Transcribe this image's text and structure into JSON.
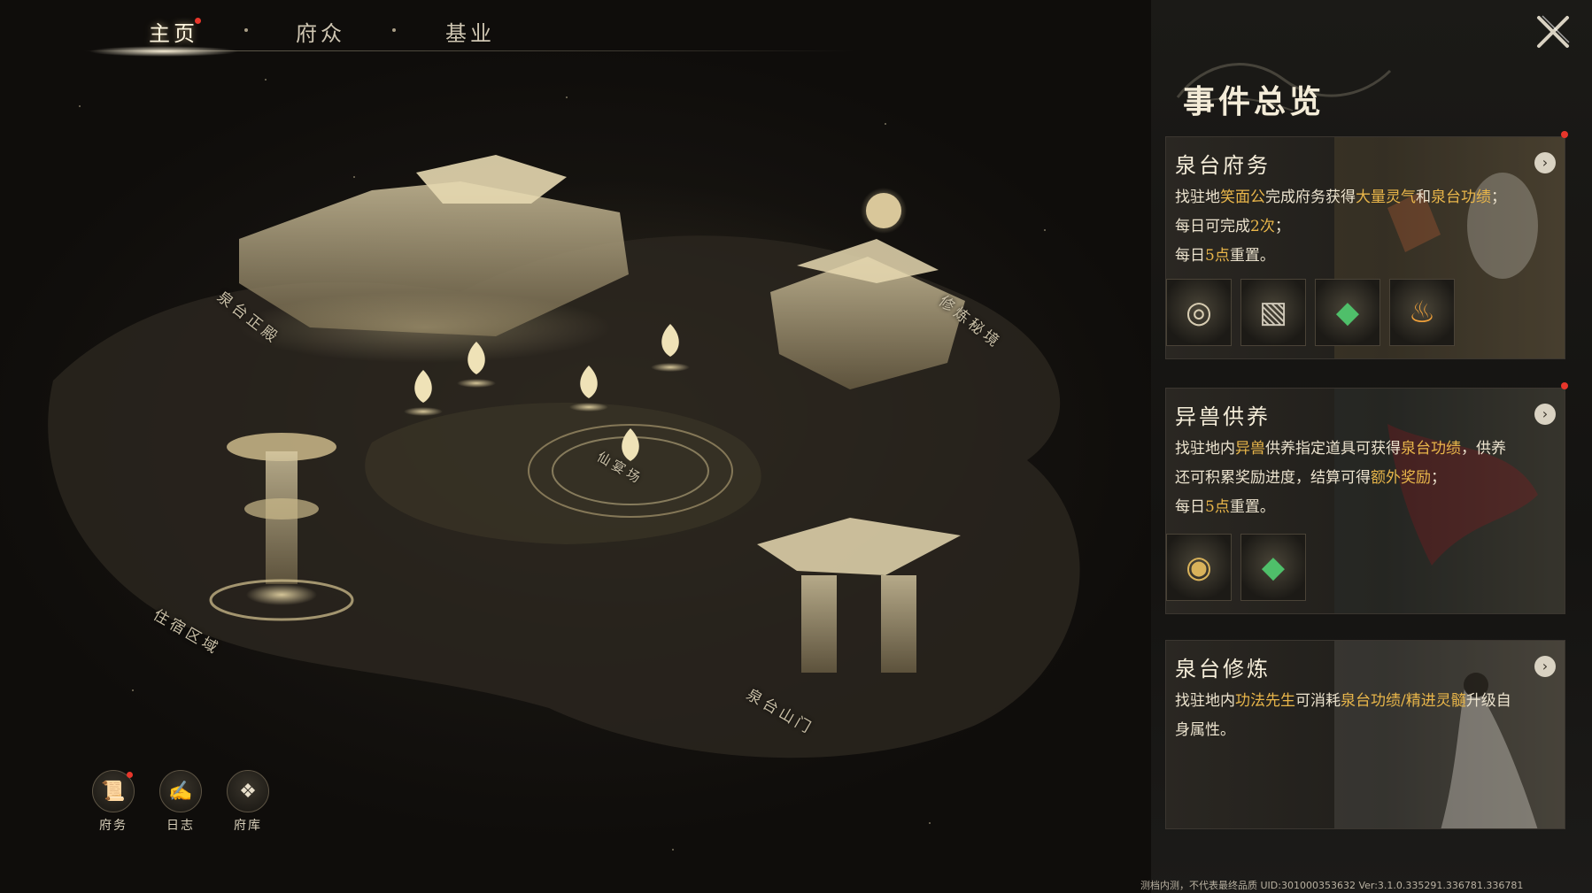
{
  "tabs": [
    {
      "label": "主页",
      "active": true,
      "badge": true
    },
    {
      "label": "府众",
      "active": false,
      "badge": false
    },
    {
      "label": "基业",
      "active": false,
      "badge": false
    }
  ],
  "map": {
    "labels": {
      "main_hall": "泉台正殿",
      "cultivation": "修炼秘境",
      "plaza": "仙宴场",
      "residence": "住宿区域",
      "gate": "泉台山门"
    }
  },
  "quick_buttons": [
    {
      "label": "府务",
      "icon": "scroll-icon",
      "badge": true
    },
    {
      "label": "日志",
      "icon": "journal-icon",
      "badge": false
    },
    {
      "label": "府库",
      "icon": "storehouse-icon",
      "badge": false
    }
  ],
  "panel": {
    "title": "事件总览",
    "cards": [
      {
        "title": "泉台府务",
        "badge": true,
        "lines": [
          [
            {
              "t": "找驻地",
              "hl": false
            },
            {
              "t": "笑面公",
              "hl": true
            },
            {
              "t": "完成府务获得",
              "hl": false
            },
            {
              "t": "大量灵气",
              "hl": true
            },
            {
              "t": "和",
              "hl": false
            },
            {
              "t": "泉台功绩",
              "hl": true
            },
            {
              "t": "；",
              "hl": false
            }
          ],
          [
            {
              "t": "每日可完成",
              "hl": false
            },
            {
              "t": "2次",
              "hl": true
            },
            {
              "t": "；",
              "hl": false
            }
          ],
          [
            {
              "t": "每日",
              "hl": false
            },
            {
              "t": "5点",
              "hl": true
            },
            {
              "t": "重置。",
              "hl": false
            }
          ]
        ],
        "items": [
          "ring-token-icon",
          "seal-paper-icon",
          "jade-token-icon",
          "flame-icon"
        ]
      },
      {
        "title": "异兽供养",
        "badge": true,
        "lines": [
          [
            {
              "t": "找驻地内",
              "hl": false
            },
            {
              "t": "异兽",
              "hl": true
            },
            {
              "t": "供养指定道具可获得",
              "hl": false
            },
            {
              "t": "泉台功绩",
              "hl": true
            },
            {
              "t": "，供养",
              "hl": false
            }
          ],
          [
            {
              "t": "还可积累奖励进度，结算可得",
              "hl": false
            },
            {
              "t": "额外奖励",
              "hl": true
            },
            {
              "t": "；",
              "hl": false
            }
          ],
          [
            {
              "t": "每日",
              "hl": false
            },
            {
              "t": "5点",
              "hl": true
            },
            {
              "t": "重置。",
              "hl": false
            }
          ]
        ],
        "items": [
          "coin-icon",
          "jade-token-icon"
        ]
      },
      {
        "title": "泉台修炼",
        "badge": false,
        "lines": [
          [
            {
              "t": "找驻地内",
              "hl": false
            },
            {
              "t": "功法先生",
              "hl": true
            },
            {
              "t": "可消耗",
              "hl": false
            },
            {
              "t": "泉台功绩/精进灵髓",
              "hl": true
            },
            {
              "t": "升级自",
              "hl": false
            }
          ],
          [
            {
              "t": "身属性。",
              "hl": false
            }
          ]
        ],
        "items": []
      }
    ]
  },
  "footer": "测档内测，不代表最终品质  UID:301000353632  Ver:3.1.0.335291.336781.336781",
  "colors": {
    "highlight": "#e9b64a",
    "badge": "#e8362b",
    "panel_bg": "#1b1a17"
  }
}
